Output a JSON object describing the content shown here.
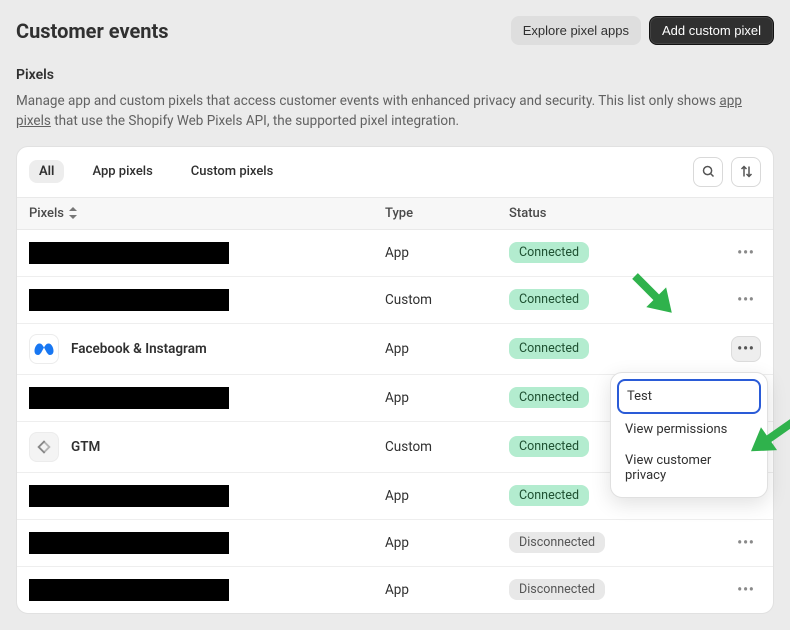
{
  "header": {
    "title": "Customer events",
    "explore_btn": "Explore pixel apps",
    "add_btn": "Add custom pixel"
  },
  "section": {
    "heading": "Pixels",
    "desc_pre": "Manage app and custom pixels that access customer events with enhanced privacy and security. This list only shows ",
    "desc_link": "app pixels",
    "desc_post": " that use the Shopify Web Pixels API, the supported pixel integration."
  },
  "tabs": {
    "all": "All",
    "app": "App pixels",
    "custom": "Custom pixels"
  },
  "table": {
    "col_pixels": "Pixels",
    "col_type": "Type",
    "col_status": "Status"
  },
  "status": {
    "connected": "Connected",
    "disconnected": "Disconnected"
  },
  "types": {
    "app": "App",
    "custom": "Custom"
  },
  "rows": [
    {
      "name": null,
      "icon": null,
      "type": "app",
      "status": "connected"
    },
    {
      "name": null,
      "icon": null,
      "type": "custom",
      "status": "connected"
    },
    {
      "name": "Facebook & Instagram",
      "icon": "meta",
      "type": "app",
      "status": "connected",
      "menu_open": true
    },
    {
      "name": null,
      "icon": null,
      "type": "app",
      "status": "connected"
    },
    {
      "name": "GTM",
      "icon": "gtm",
      "type": "custom",
      "status": "connected"
    },
    {
      "name": null,
      "icon": null,
      "type": "app",
      "status": "connected"
    },
    {
      "name": null,
      "icon": null,
      "type": "app",
      "status": "disconnected"
    },
    {
      "name": null,
      "icon": null,
      "type": "app",
      "status": "disconnected"
    }
  ],
  "popover": {
    "test": "Test",
    "view_permissions": "View permissions",
    "view_privacy": "View customer privacy"
  }
}
